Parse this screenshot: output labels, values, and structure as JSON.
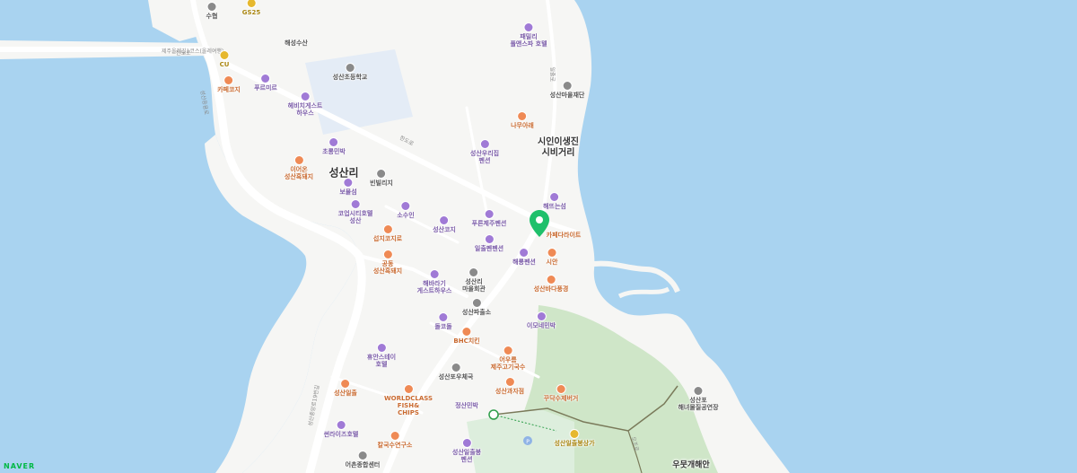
{
  "map": {
    "colors": {
      "water": "#a9d3f0",
      "land": "#f6f6f4",
      "road": "#ffffff",
      "park": "#cfe6c8",
      "school": "#e4ecf6",
      "marker": "#1fc06b"
    },
    "brand": "NAVER",
    "place_labels": [
      {
        "name": "시인이생진\n시비거리",
        "lines": [
          "시인이생진",
          "시비거리"
        ]
      },
      {
        "name": "성산리"
      },
      {
        "name": "우뭇개해안"
      }
    ],
    "road_labels": [
      "제주올레길1코스(올레여행)",
      "한도로",
      "한도로",
      "일출로",
      "성산등용로",
      "성산중앙로19번길",
      "오조로"
    ],
    "marker": {
      "name": "카페다라이트"
    },
    "pois": [
      {
        "name": "수협",
        "type": "public"
      },
      {
        "name": "GS25",
        "type": "store"
      },
      {
        "name": "CU",
        "type": "store"
      },
      {
        "name": "해성수산",
        "type": "public"
      },
      {
        "name": "패밀리\n풀앤스파 호텔",
        "lines": [
          "패밀리",
          "풀앤스파 호텔"
        ],
        "type": "lodging"
      },
      {
        "name": "성산초등학교",
        "type": "public"
      },
      {
        "name": "성산마을재단",
        "type": "public"
      },
      {
        "name": "카페코지",
        "type": "food"
      },
      {
        "name": "푸르미르",
        "type": "lodging"
      },
      {
        "name": "헤비치게스트\n하우스",
        "lines": [
          "헤비치게스트",
          "하우스"
        ],
        "type": "lodging"
      },
      {
        "name": "나무아래",
        "type": "food"
      },
      {
        "name": "초롱민박",
        "type": "lodging"
      },
      {
        "name": "성산우리집\n펜션",
        "lines": [
          "성산우리집",
          "펜션"
        ],
        "type": "lodging"
      },
      {
        "name": "이어온\n성산흑돼지",
        "lines": [
          "이어온",
          "성산흑돼지"
        ],
        "type": "food"
      },
      {
        "name": "빈빌리지",
        "type": "public"
      },
      {
        "name": "보물섬",
        "type": "lodging"
      },
      {
        "name": "해뜨는섬",
        "type": "lodging"
      },
      {
        "name": "코업시티호텔\n성산",
        "lines": [
          "코업시티호텔",
          "성산"
        ],
        "type": "lodging"
      },
      {
        "name": "소수인",
        "type": "lodging"
      },
      {
        "name": "푸른제주펜션",
        "type": "lodging"
      },
      {
        "name": "성산코지",
        "type": "lodging"
      },
      {
        "name": "섭지코지로",
        "type": "food"
      },
      {
        "name": "일출펜펜션",
        "type": "lodging"
      },
      {
        "name": "해룡펜션",
        "type": "lodging"
      },
      {
        "name": "시안",
        "type": "food"
      },
      {
        "name": "공동\n성산흑돼지",
        "lines": [
          "공동",
          "성산흑돼지"
        ],
        "type": "food"
      },
      {
        "name": "해바라기\n게스트하우스",
        "lines": [
          "해바라기",
          "게스트하우스"
        ],
        "type": "lodging"
      },
      {
        "name": "성산리\n마을회관",
        "lines": [
          "성산리",
          "마을회관"
        ],
        "type": "public"
      },
      {
        "name": "성산바다풍경",
        "type": "food"
      },
      {
        "name": "성산파출소",
        "type": "public"
      },
      {
        "name": "이모네민박",
        "type": "lodging"
      },
      {
        "name": "돌코돌",
        "type": "lodging"
      },
      {
        "name": "BHC치킨",
        "type": "food"
      },
      {
        "name": "어우름\n제주고기국수",
        "lines": [
          "어우름",
          "제주고기국수"
        ],
        "type": "food"
      },
      {
        "name": "휴안스테이\n호텔",
        "lines": [
          "휴안스테이",
          "호텔"
        ],
        "type": "lodging"
      },
      {
        "name": "성산포우체국",
        "type": "public"
      },
      {
        "name": "성산일출",
        "type": "food"
      },
      {
        "name": "성산과자점",
        "type": "food"
      },
      {
        "name": "WORLDCLASS\nFISH&\nCHIPS",
        "lines": [
          "WORLDCLASS",
          "FISH&",
          "CHIPS"
        ],
        "type": "food"
      },
      {
        "name": "꾸닥수제버거",
        "type": "food"
      },
      {
        "name": "성산포\n해녀물질공연장",
        "lines": [
          "성산포",
          "해녀물질공연장"
        ],
        "type": "public"
      },
      {
        "name": "정산민박",
        "type": "lodging"
      },
      {
        "name": "썬라이즈호텔",
        "type": "lodging"
      },
      {
        "name": "칼국수연구소",
        "type": "food"
      },
      {
        "name": "성산일출봉\n펜션",
        "lines": [
          "성산일출봉",
          "펜션"
        ],
        "type": "lodging"
      },
      {
        "name": "성산일출봉상가",
        "type": "store"
      },
      {
        "name": "어촌종합센터",
        "type": "public"
      }
    ]
  }
}
